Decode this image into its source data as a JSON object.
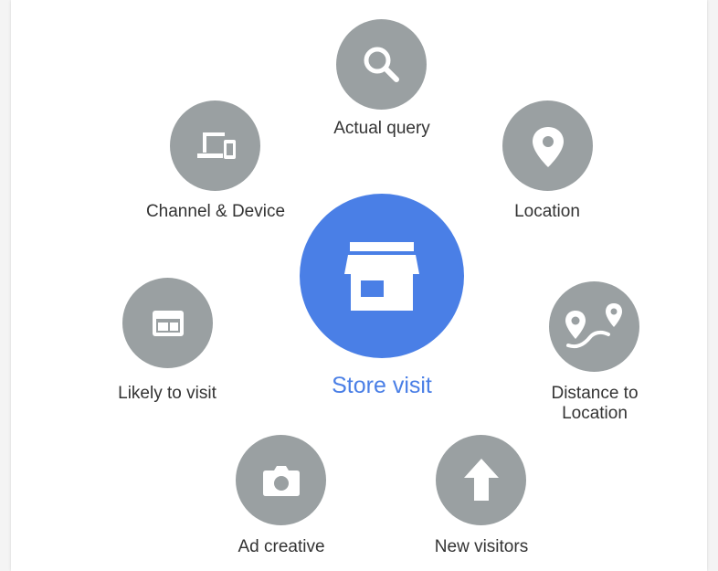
{
  "colors": {
    "node": "#9aa0a2",
    "center": "#4a7fe6",
    "label": "#333333",
    "center_label": "#4a7fe6",
    "icon": "#ffffff"
  },
  "center": {
    "label": "Store visit",
    "icon": "storefront-icon"
  },
  "factors": [
    {
      "id": "actual-query",
      "label": "Actual query",
      "icon": "search-icon"
    },
    {
      "id": "location",
      "label": "Location",
      "icon": "location-pin-icon"
    },
    {
      "id": "distance-to-location",
      "label": "Distance to\nLocation",
      "icon": "route-icon"
    },
    {
      "id": "new-visitors",
      "label": "New visitors",
      "icon": "arrow-up-icon"
    },
    {
      "id": "ad-creative",
      "label": "Ad creative",
      "icon": "camera-icon"
    },
    {
      "id": "likely-to-visit",
      "label": "Likely to visit",
      "icon": "calendar-card-icon"
    },
    {
      "id": "channel-device",
      "label": "Channel & Device",
      "icon": "devices-icon"
    }
  ]
}
